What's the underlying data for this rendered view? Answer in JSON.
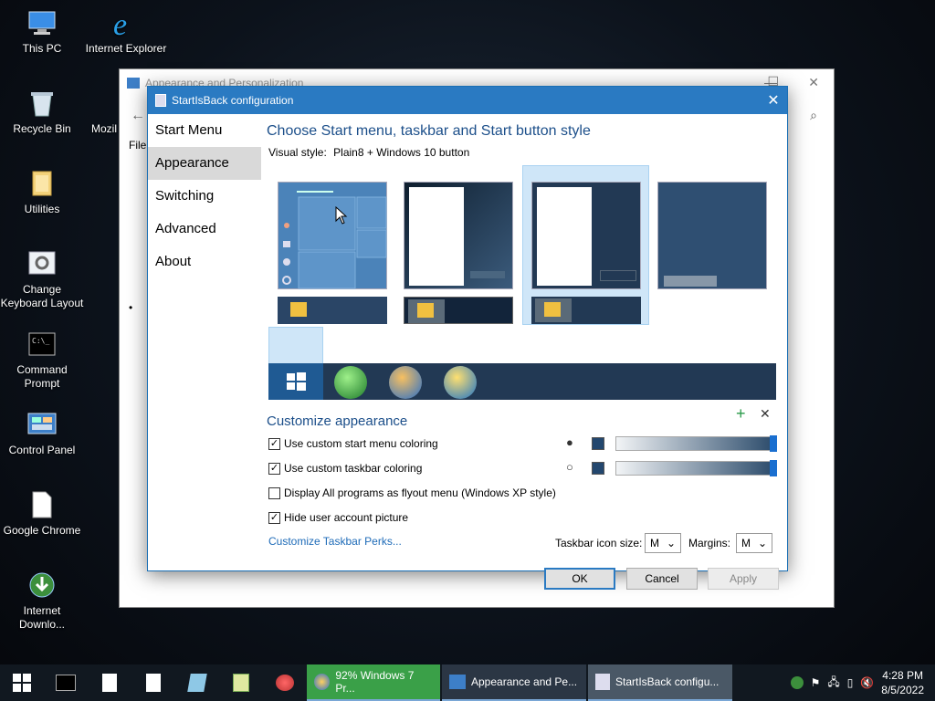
{
  "desktop": {
    "icons": [
      {
        "label": "This PC",
        "icon": "computer-icon"
      },
      {
        "label": "Internet Explorer",
        "icon": "ie-icon"
      },
      {
        "label": "Recycle Bin",
        "icon": "recycle-bin-icon"
      },
      {
        "label": "Mozil",
        "icon": "firefox-icon"
      },
      {
        "label": "Utilities",
        "icon": "folder-icon"
      },
      {
        "label": "Change Keyboard Layout",
        "icon": "settings-icon"
      },
      {
        "label": "Command Prompt",
        "icon": "cmd-icon"
      },
      {
        "label": "Control Panel",
        "icon": "control-panel-icon"
      },
      {
        "label": "Google Chrome",
        "icon": "file-icon"
      },
      {
        "label": "Internet Downlo...",
        "icon": "download-manager-icon"
      }
    ]
  },
  "background_window": {
    "title": "Appearance and Personalization",
    "menu_text": "File"
  },
  "dialog": {
    "title": "StartIsBack configuration",
    "sidebar": [
      "Start Menu",
      "Appearance",
      "Switching",
      "Advanced",
      "About"
    ],
    "active_tab": "Appearance",
    "heading": "Choose Start menu, taskbar and Start button style",
    "visual_style_label": "Visual style:",
    "visual_style_value": "Plain8 + Windows 10 button",
    "customize_heading": "Customize appearance",
    "options": [
      {
        "label": "Use custom start menu coloring",
        "checked": true
      },
      {
        "label": "Use custom taskbar coloring",
        "checked": true
      },
      {
        "label": "Display All programs as flyout menu (Windows XP style)",
        "checked": false
      },
      {
        "label": "Hide user account picture",
        "checked": true
      }
    ],
    "link": "Customize Taskbar Perks...",
    "icon_size_label": "Taskbar icon size:",
    "icon_size_value": "M",
    "margins_label": "Margins:",
    "margins_value": "M",
    "buttons": {
      "ok": "OK",
      "cancel": "Cancel",
      "apply": "Apply"
    },
    "accent_color": "#23476e"
  },
  "taskbar": {
    "tasks": [
      {
        "label": "92% Windows 7 Pr...",
        "icon": "progress-icon"
      },
      {
        "label": "Appearance and Pe...",
        "icon": "control-panel-icon"
      },
      {
        "label": "StartIsBack configu...",
        "icon": "window-icon"
      }
    ],
    "time": "4:28 PM",
    "date": "8/5/2022"
  }
}
